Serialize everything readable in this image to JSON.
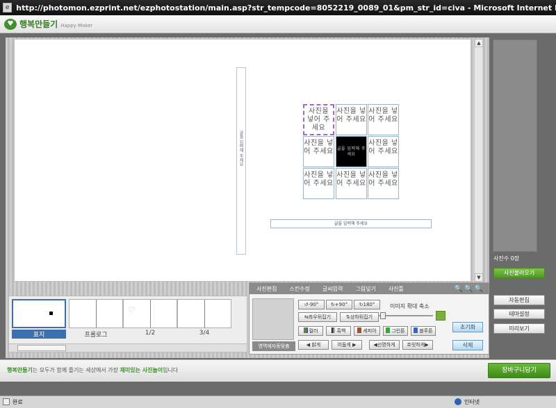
{
  "window": {
    "title": "http://photomon.ezprint.net/ezphotostation/main.asp?str_tempcode=8052219_0089_01&pm_str_id=civa - Microsoft Internet Explorer"
  },
  "app": {
    "logo_text": "행복만들기",
    "logo_sub": "Happy Maker"
  },
  "canvas": {
    "spine_text": "글을 입력해 주세요",
    "cells": [
      "사진을 넣어 주세요",
      "사진을 넣어 주세요",
      "사진을 넣어 주세요",
      "사진을 넣어 주세요",
      "글을 입력해 주세요",
      "사진을 넣어 주세요",
      "사진을 넣어 주세요",
      "사진을 넣어 주세요",
      "사진을 넣어 주세요"
    ],
    "text_strip": "글을 입력해 주세요"
  },
  "right_panel": {
    "photo_count": "사진수 0장",
    "load_photos": "사진불러오기",
    "auto_edit": "자동편집",
    "theme_setting": "테마설정",
    "preview": "미리보기"
  },
  "thumbs": [
    {
      "label": "표지"
    },
    {
      "label": "프롤로그"
    },
    {
      "label": "1/2"
    },
    {
      "label": "3/4"
    }
  ],
  "edit_panel": {
    "tabs": [
      "사진편집",
      "스킨수정",
      "글씨입력",
      "그림넣기",
      "사진틀"
    ],
    "zoom_icons": "🔍🔍🔍",
    "rotate_left": "-90°",
    "rotate_right": "+90°",
    "rotate_180": "180°",
    "zoom_label": "이미지 확대 축소",
    "mirror_lr": "좌우뒤집기",
    "mirror_ud": "상하뒤집기",
    "color": "컬러",
    "bw": "흑백",
    "sepia": "세피아",
    "green": "그린톤",
    "blue": "블루톤",
    "reset": "초기화",
    "delete": "삭제",
    "area_auto": "영역에자동맞춤",
    "brighter": "밝게",
    "darker": "어둡게",
    "sharper": "선명하게",
    "softer": "흐릿하게",
    "slider_fraction": 0.1
  },
  "footer": {
    "brand": "행복만들기",
    "text_mid": "는 모두가 함께 즐기는 세상에서 가장 ",
    "highlight": "재미있는 사진놀이",
    "text_end": "입니다",
    "cart": "장바구니담기"
  },
  "status": {
    "left": "완료",
    "zone": "인터넷"
  }
}
